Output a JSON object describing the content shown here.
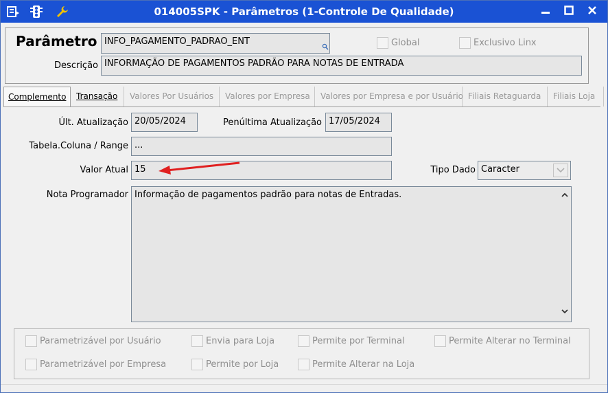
{
  "window": {
    "title": "014005SPK - Parâmetros (1-Controle De Qualidade)",
    "titlebar_color": "#1a52d4",
    "icons": [
      "menu-icon",
      "traffic-light-icon",
      "wrench-icon"
    ],
    "controls": {
      "minimize": "▬",
      "maximize": "□",
      "close": "✕"
    }
  },
  "header": {
    "parametro_label": "Parâmetro",
    "parametro_value": "INFO_PAGAMENTO_PADRAO_ENT",
    "descricao_label": "Descrição",
    "descricao_value": "INFORMAÇÃO DE PAGAMENTOS PADRÃO PARA NOTAS DE ENTRADA",
    "global_label": "Global",
    "exclusivo_label": "Exclusivo Linx"
  },
  "tabs": [
    {
      "label": "Complemento",
      "state": "active"
    },
    {
      "label": "Transação",
      "state": "enabled"
    },
    {
      "label": "Valores Por Usuários",
      "state": "disabled"
    },
    {
      "label": "Valores por Empresa",
      "state": "disabled"
    },
    {
      "label": "Valores por Empresa e por Usuário",
      "state": "disabled"
    },
    {
      "label": "Filiais Retaguarda",
      "state": "disabled"
    },
    {
      "label": "Filiais Loja",
      "state": "disabled"
    }
  ],
  "complemento": {
    "ult_atualizacao_label": "Últ. Atualização",
    "ult_atualizacao_value": "20/05/2024",
    "penultima_label": "Penúltima Atualização",
    "penultima_value": "17/05/2024",
    "tabela_label": "Tabela.Coluna / Range",
    "tabela_value": "...",
    "valor_atual_label": "Valor Atual",
    "valor_atual_value": "15",
    "tipo_dado_label": "Tipo Dado",
    "tipo_dado_value": "Caracter",
    "nota_label": "Nota Programador",
    "nota_value": "Informação de pagamentos padrão para notas de Entradas."
  },
  "checkboxes": {
    "parametrizavel_usuario": "Parametrizável por Usuário",
    "envia_loja": "Envia para Loja",
    "permite_terminal": "Permite por Terminal",
    "permite_alterar_terminal": "Permite Alterar no Terminal",
    "parametrizavel_empresa": "Parametrizável por Empresa",
    "permite_loja": "Permite por Loja",
    "permite_alterar_loja": "Permite Alterar na Loja"
  },
  "annotation_color": "#e02020"
}
